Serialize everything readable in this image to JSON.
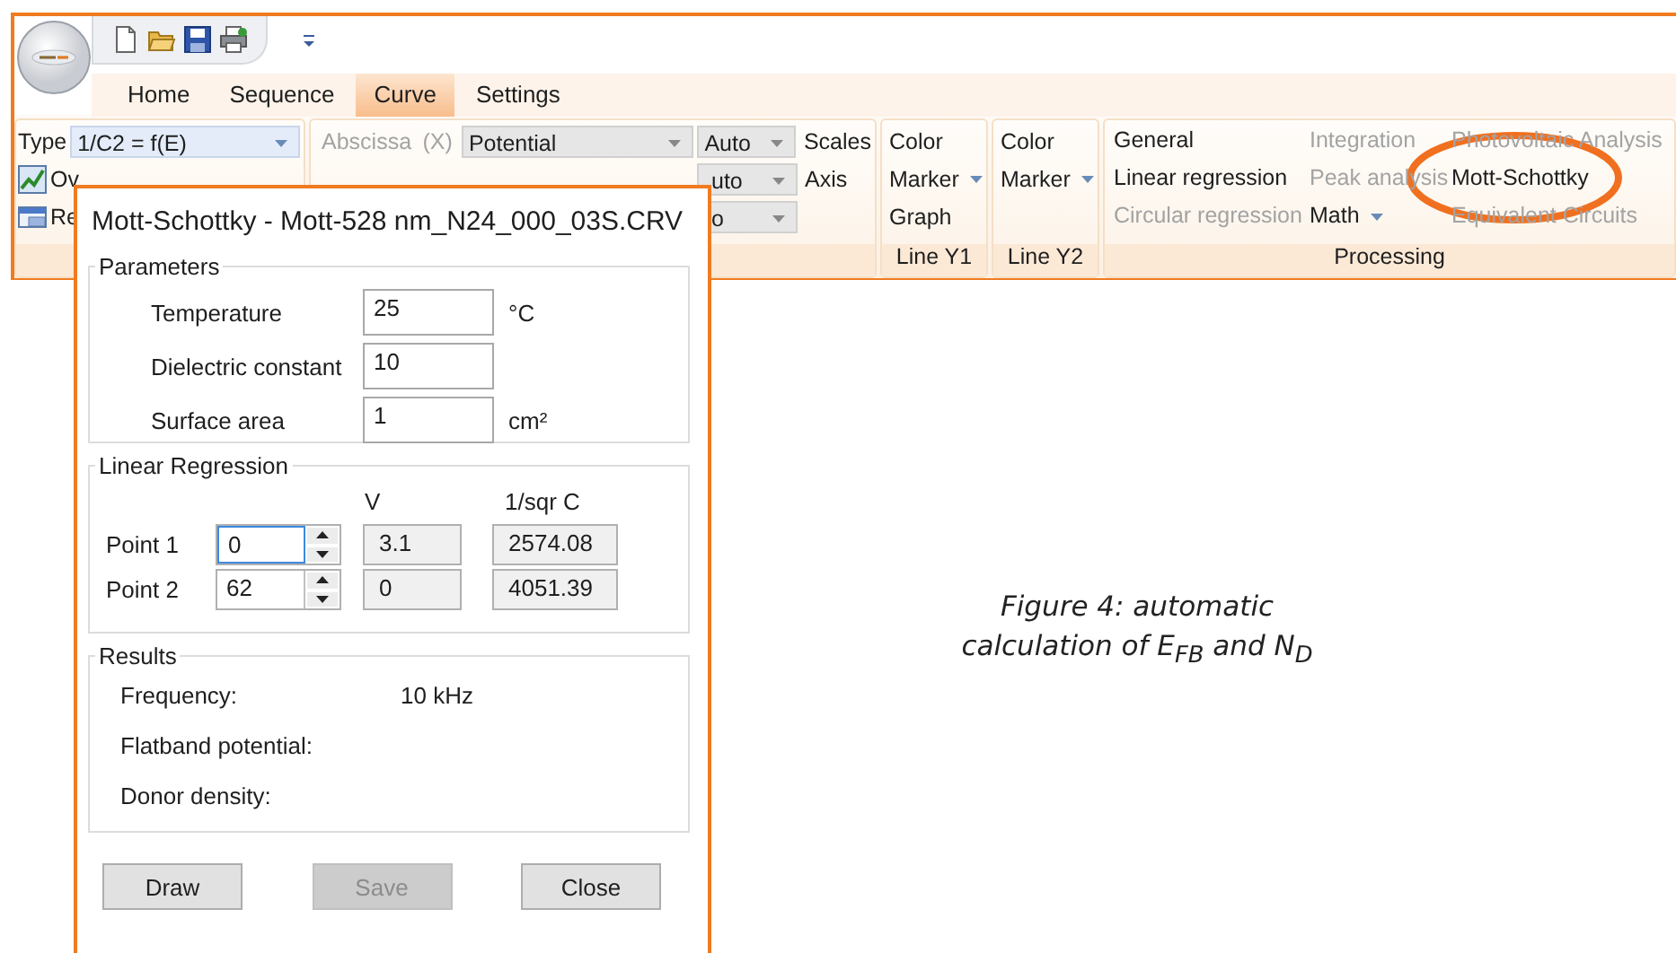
{
  "tabs": [
    {
      "label": "Home",
      "selected": false
    },
    {
      "label": "Sequence",
      "selected": false
    },
    {
      "label": "Curve",
      "selected": true
    },
    {
      "label": "Settings",
      "selected": false
    }
  ],
  "type_group": {
    "label": "Type",
    "value": "1/C2 = f(E)",
    "items": [
      {
        "kind": "chart",
        "label": "Ov"
      },
      {
        "kind": "window",
        "label": "Re"
      }
    ]
  },
  "axes_group": {
    "abscissa": {
      "label": "Abscissa",
      "disabled": true
    },
    "axis_letter": {
      "label": "(X)",
      "disabled": true
    },
    "abscissa_value": "Potential",
    "scale_rows": [
      {
        "value": "Auto",
        "cut": false,
        "label": "Scales"
      },
      {
        "value": "uto",
        "cut": true,
        "label": "Axis"
      },
      {
        "value": "o",
        "cut": true
      }
    ]
  },
  "line_groups": [
    {
      "caption": "Line Y1",
      "items": [
        {
          "label": "Color",
          "dropdown": false
        },
        {
          "label": "Marker",
          "dropdown": true
        },
        {
          "label": "Graph",
          "dropdown": false
        }
      ]
    },
    {
      "caption": "Line Y2",
      "items": [
        {
          "label": "Color",
          "dropdown": false
        },
        {
          "label": "Marker",
          "dropdown": true
        }
      ]
    }
  ],
  "processing": {
    "caption": "Processing",
    "columns": [
      [
        {
          "label": "General",
          "disabled": false,
          "dropdown": false
        },
        {
          "label": "Linear regression",
          "disabled": false,
          "dropdown": false
        },
        {
          "label": "Circular regression",
          "disabled": true,
          "dropdown": false
        }
      ],
      [
        {
          "label": "Integration",
          "disabled": true,
          "dropdown": false
        },
        {
          "label": "Peak analysis",
          "disabled": true,
          "dropdown": false
        },
        {
          "label": "Math",
          "disabled": false,
          "dropdown": true
        }
      ],
      [
        {
          "label": "Photovoltaic Analysis",
          "disabled": true,
          "dropdown": false
        },
        {
          "label": "Mott-Schottky",
          "disabled": false,
          "dropdown": false
        },
        {
          "label": "Equivalent Circuits",
          "disabled": true,
          "dropdown": false
        }
      ]
    ]
  },
  "dialog": {
    "title": "Mott-Schottky - Mott-528 nm_N24_000_03S.CRV",
    "parameters": {
      "title": "Parameters",
      "fields": [
        {
          "label": "Temperature",
          "value": "25",
          "unit": "°C"
        },
        {
          "label": "Dielectric constant",
          "value": "10"
        },
        {
          "label": "Surface area",
          "value": "1",
          "unit": "cm²"
        }
      ]
    },
    "regression": {
      "title": "Linear Regression",
      "columns": [
        "V",
        "1/sqr C"
      ],
      "points": [
        {
          "label": "Point 1",
          "value": "0",
          "focused": true,
          "v": "3.1",
          "c": "2574.08"
        },
        {
          "label": "Point 2",
          "value": "62",
          "focused": false,
          "v": "0",
          "c": "4051.39"
        }
      ]
    },
    "results": {
      "title": "Results",
      "rows": [
        {
          "label": "Frequency:",
          "value": "10 kHz"
        },
        {
          "label": "Flatband potential:"
        },
        {
          "label": "Donor density:"
        }
      ]
    },
    "buttons": [
      {
        "label": "Draw",
        "disabled": false
      },
      {
        "label": "Save",
        "disabled": true
      },
      {
        "label": "Close",
        "disabled": false
      }
    ]
  },
  "caption": "Figure 4: automatic calculation of E$_{FB}$ and N$_{D}$"
}
